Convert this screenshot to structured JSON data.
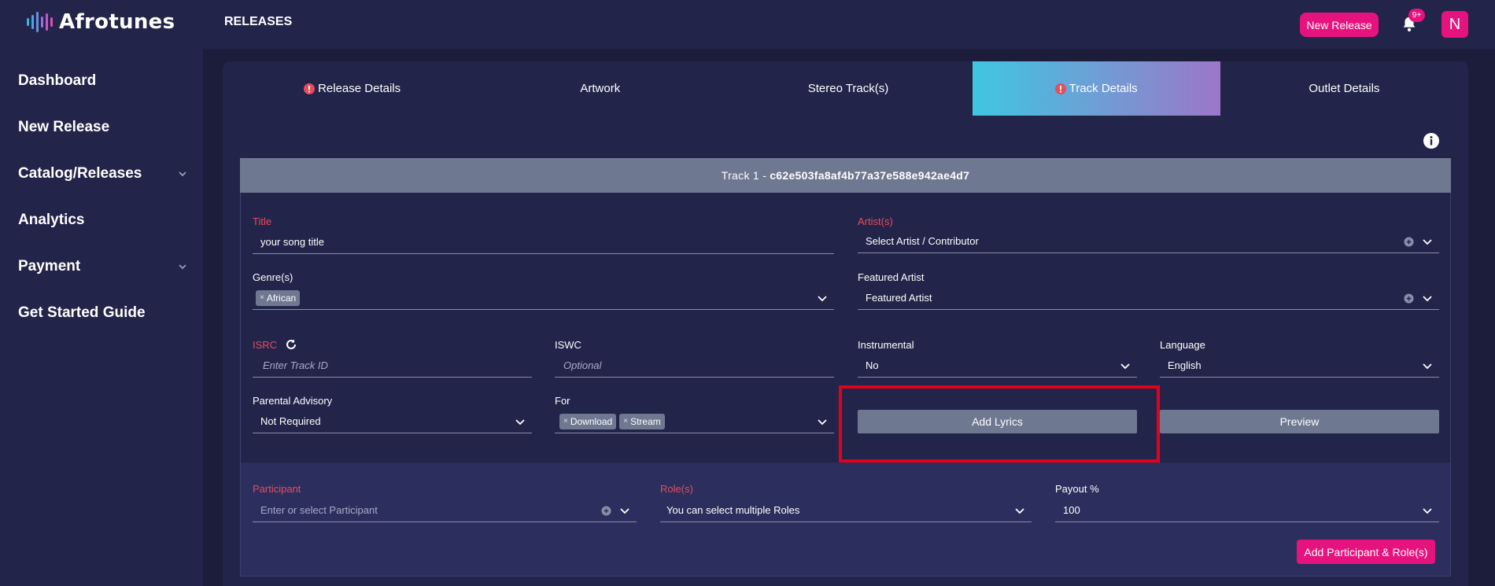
{
  "header": {
    "app_name": "Afrotunes",
    "page_title": "RELEASES",
    "new_release_label": "New Release",
    "notifications_count": "9+",
    "avatar_initial": "N"
  },
  "sidebar": {
    "items": [
      {
        "label": "Dashboard",
        "has_chevron": false
      },
      {
        "label": "New Release",
        "has_chevron": false
      },
      {
        "label": "Catalog/Releases",
        "has_chevron": true
      },
      {
        "label": "Analytics",
        "has_chevron": false
      },
      {
        "label": "Payment",
        "has_chevron": true
      },
      {
        "label": "Get Started Guide",
        "has_chevron": false
      }
    ]
  },
  "tabs": [
    {
      "label": "Release Details",
      "warning": true,
      "active": false
    },
    {
      "label": "Artwork",
      "warning": false,
      "active": false
    },
    {
      "label": "Stereo Track(s)",
      "warning": false,
      "active": false
    },
    {
      "label": "Track Details",
      "warning": true,
      "active": true
    },
    {
      "label": "Outlet Details",
      "warning": false,
      "active": false
    }
  ],
  "track": {
    "header_prefix": "Track 1 -",
    "header_id": "c62e503fa8af4b77a37e588e942ae4d7",
    "title_label": "Title",
    "title_value": "your song title",
    "artists_label": "Artist(s)",
    "artists_placeholder": "Select Artist / Contributor",
    "genres_label": "Genre(s)",
    "genres": [
      "African"
    ],
    "featured_label": "Featured Artist",
    "featured_placeholder": "Featured Artist",
    "isrc_label": "ISRC",
    "isrc_placeholder": "Enter Track ID",
    "iswc_label": "ISWC",
    "iswc_placeholder": "Optional",
    "instrumental_label": "Instrumental",
    "instrumental_value": "No",
    "language_label": "Language",
    "language_value": "English",
    "parental_label": "Parental Advisory",
    "parental_value": "Not Required",
    "for_label": "For",
    "for_values": [
      "Download",
      "Stream"
    ],
    "add_lyrics_label": "Add Lyrics",
    "preview_label": "Preview"
  },
  "participant": {
    "participant_label": "Participant",
    "participant_placeholder": "Enter or select Participant",
    "roles_label": "Role(s)",
    "roles_placeholder": "You can select multiple Roles",
    "payout_label": "Payout %",
    "payout_value": "100",
    "add_button_label": "Add Participant & Role(s)"
  },
  "colors": {
    "accent": "#e6137f",
    "background": "#1c1d3b",
    "panel": "#23244a",
    "required_label": "#e54d5d",
    "highlight": "#e3001b"
  }
}
